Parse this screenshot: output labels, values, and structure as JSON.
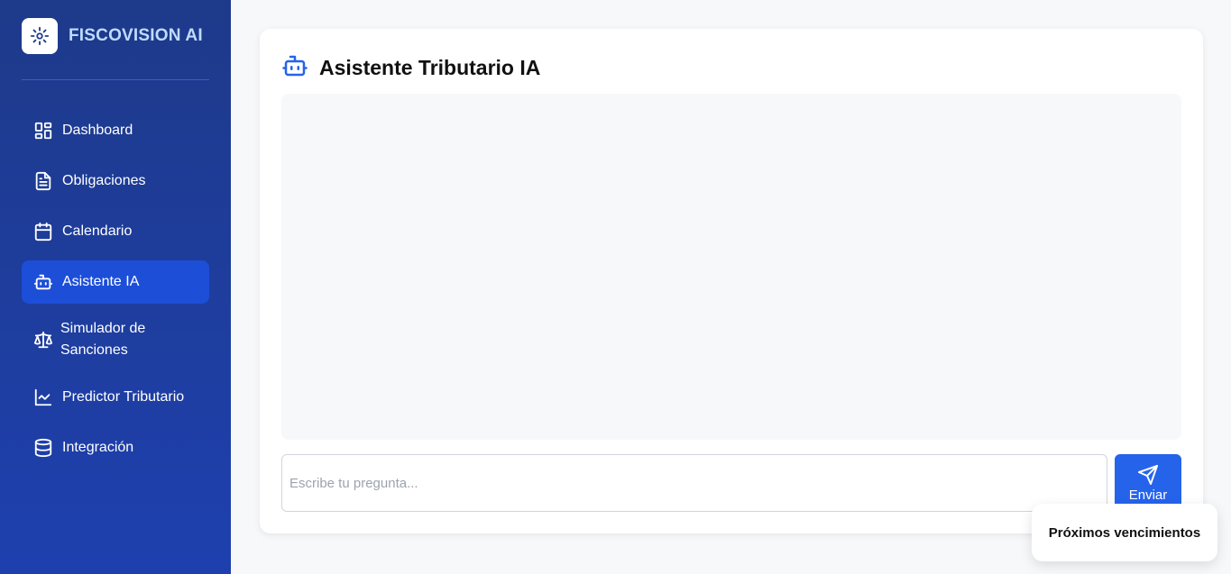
{
  "brand": {
    "name": "FISCOVISION AI"
  },
  "nav": {
    "items": [
      {
        "label": "Dashboard",
        "icon": "dashboard-icon"
      },
      {
        "label": "Obligaciones",
        "icon": "document-icon"
      },
      {
        "label": "Calendario",
        "icon": "calendar-icon"
      },
      {
        "label": "Asistente IA",
        "icon": "robot-icon",
        "active": true
      },
      {
        "label": "Simulador de Sanciones",
        "icon": "scale-icon"
      },
      {
        "label": "Predictor Tributario",
        "icon": "chart-line-icon"
      },
      {
        "label": "Integración",
        "icon": "database-icon"
      }
    ]
  },
  "assistant": {
    "title": "Asistente Tributario IA",
    "input_placeholder": "Escribe tu pregunta...",
    "send_label": "Enviar"
  },
  "popup": {
    "title": "Próximos vencimientos"
  },
  "colors": {
    "sidebar": "#1e3a8a",
    "accent": "#2563eb",
    "active_nav": "#1d4ed8"
  }
}
